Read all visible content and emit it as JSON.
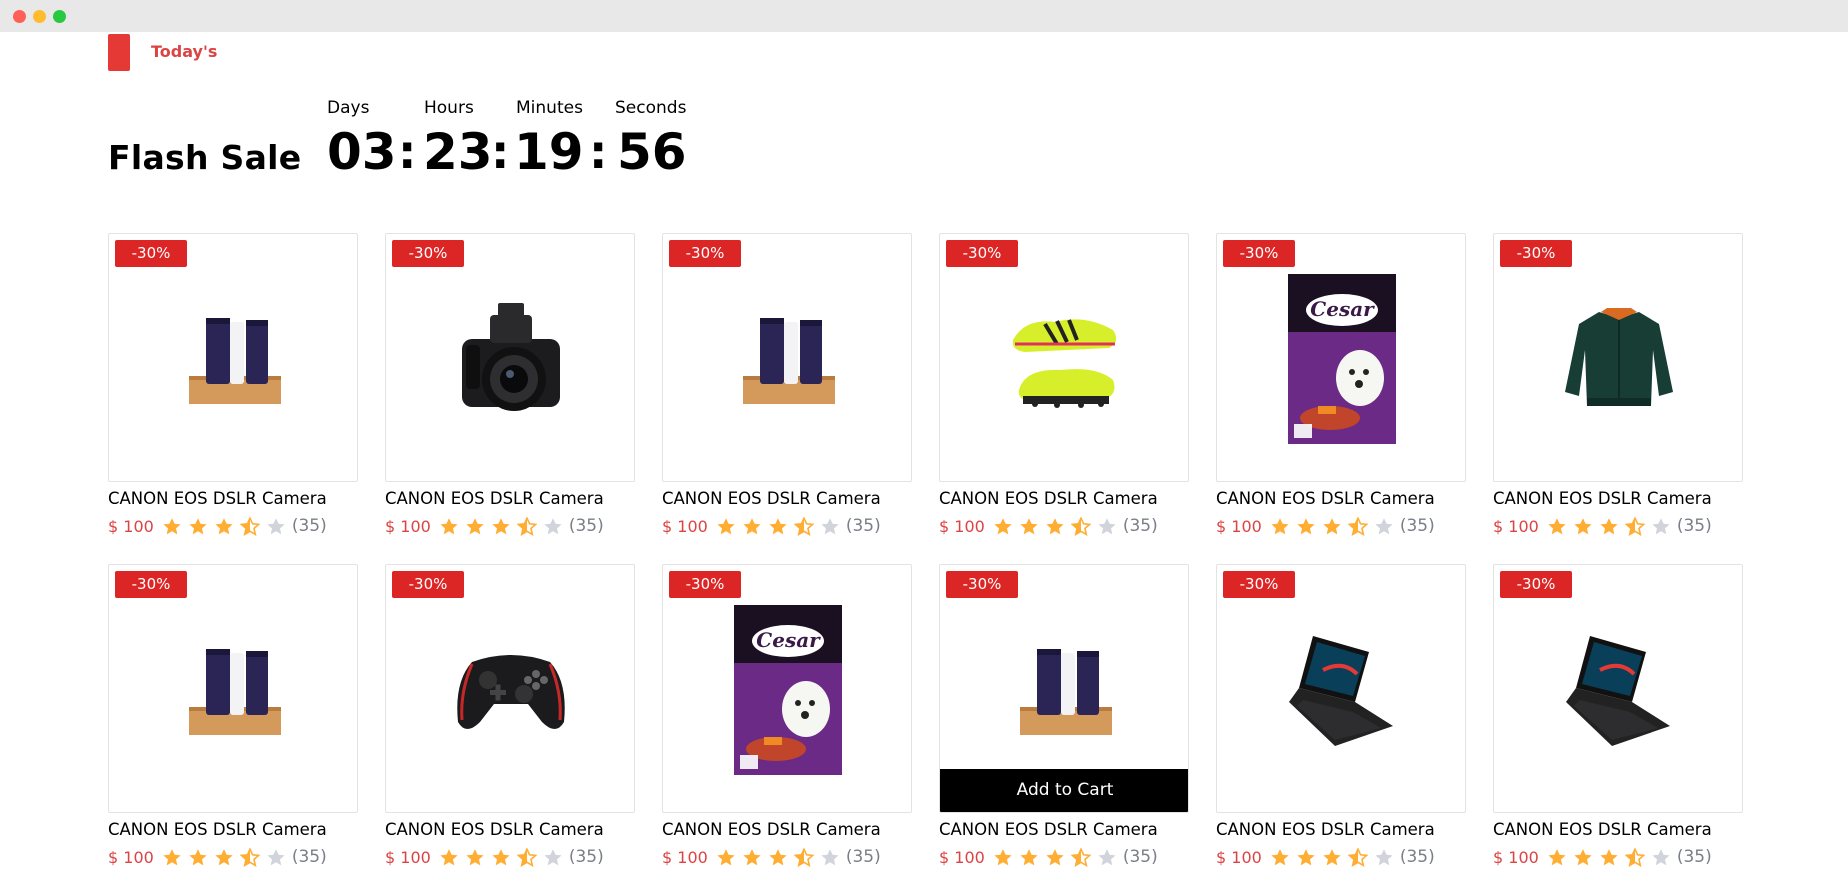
{
  "section": {
    "label": "Today's"
  },
  "title": "Flash Sale",
  "countdown": {
    "labels": {
      "days": "Days",
      "hours": "Hours",
      "minutes": "Minutes",
      "seconds": "Seconds"
    },
    "days": "03",
    "hours": "23",
    "minutes": "19",
    "seconds": "56",
    "separator": ":"
  },
  "colors": {
    "accent": "#db4444",
    "badge": "#dc2626",
    "star": "#ffad33",
    "star_empty": "#d1d5db"
  },
  "products": [
    {
      "badge": "-30%",
      "name": "CANON EOS DSLR Camera",
      "price": "$ 100",
      "rating": 3.5,
      "count": "(35)",
      "icon": "tubes-product-image"
    },
    {
      "badge": "-30%",
      "name": "CANON EOS DSLR Camera",
      "price": "$ 100",
      "rating": 3.5,
      "count": "(35)",
      "icon": "camera-product-image"
    },
    {
      "badge": "-30%",
      "name": "CANON EOS DSLR Camera",
      "price": "$ 100",
      "rating": 3.5,
      "count": "(35)",
      "icon": "tubes-product-image"
    },
    {
      "badge": "-30%",
      "name": "CANON EOS DSLR Camera",
      "price": "$ 100",
      "rating": 3.5,
      "count": "(35)",
      "icon": "soccer-cleats-product-image"
    },
    {
      "badge": "-30%",
      "name": "CANON EOS DSLR Camera",
      "price": "$ 100",
      "rating": 3.5,
      "count": "(35)",
      "icon": "dog-food-bag-product-image"
    },
    {
      "badge": "-30%",
      "name": "CANON EOS DSLR Camera",
      "price": "$ 100",
      "rating": 3.5,
      "count": "(35)",
      "icon": "jacket-product-image"
    },
    {
      "badge": "-30%",
      "name": "CANON EOS DSLR Camera",
      "price": "$ 100",
      "rating": 3.5,
      "count": "(35)",
      "icon": "tubes-product-image"
    },
    {
      "badge": "-30%",
      "name": "CANON EOS DSLR Camera",
      "price": "$ 100",
      "rating": 3.5,
      "count": "(35)",
      "icon": "gamepad-product-image"
    },
    {
      "badge": "-30%",
      "name": "CANON EOS DSLR Camera",
      "price": "$ 100",
      "rating": 3.5,
      "count": "(35)",
      "icon": "dog-food-bag-product-image"
    },
    {
      "badge": "-30%",
      "name": "CANON EOS DSLR Camera",
      "price": "$ 100",
      "rating": 3.5,
      "count": "(35)",
      "icon": "tubes-product-image",
      "hover_action": "Add to Cart"
    },
    {
      "badge": "-30%",
      "name": "CANON EOS DSLR Camera",
      "price": "$ 100",
      "rating": 3.5,
      "count": "(35)",
      "icon": "laptop-product-image"
    },
    {
      "badge": "-30%",
      "name": "CANON EOS DSLR Camera",
      "price": "$ 100",
      "rating": 3.5,
      "count": "(35)",
      "icon": "laptop-product-image"
    }
  ]
}
